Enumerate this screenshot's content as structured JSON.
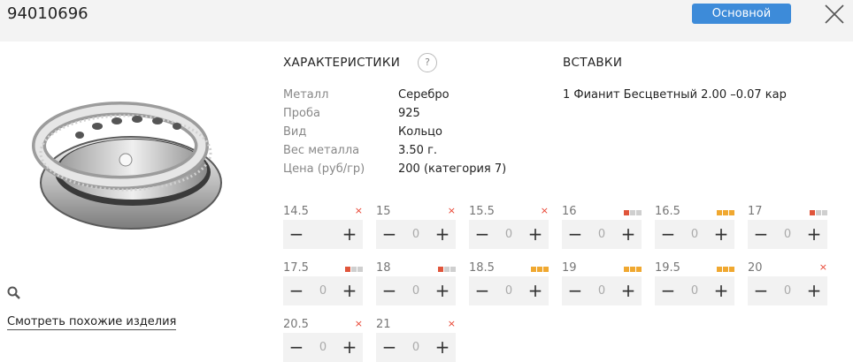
{
  "header": {
    "article": "94010696",
    "main_button": "Основной"
  },
  "image": {
    "alt": "ring"
  },
  "similar_link": "Смотреть похожие изделия",
  "characteristics": {
    "title": "ХАРАКТЕРИСТИКИ",
    "help": "?",
    "rows": [
      {
        "label": "Металл",
        "value": "Серебро"
      },
      {
        "label": "Проба",
        "value": "925"
      },
      {
        "label": "Вид",
        "value": "Кольцо"
      },
      {
        "label": "Вес металла",
        "value": "3.50 г."
      },
      {
        "label": "Цена (руб/гр)",
        "value": "200 (категория 7)"
      }
    ]
  },
  "inserts": {
    "title": "ВСТАВКИ",
    "items": [
      "1 Фианит Бесцветный 2.00 –0.07 кар"
    ]
  },
  "colors": {
    "accent": "#3d8bd9",
    "unavailable": "#e8412f",
    "bar_red": "#e0553b",
    "bar_orange": "#f0a830",
    "bar_grey": "#cfcfcf"
  },
  "sizes": [
    {
      "size": "14.5",
      "qty": "",
      "availability": "none"
    },
    {
      "size": "15",
      "qty": "0",
      "availability": "none"
    },
    {
      "size": "15.5",
      "qty": "0",
      "availability": "none"
    },
    {
      "size": "16",
      "qty": "0",
      "availability": "low"
    },
    {
      "size": "16.5",
      "qty": "0",
      "availability": "high"
    },
    {
      "size": "17",
      "qty": "0",
      "availability": "low"
    },
    {
      "size": "17.5",
      "qty": "0",
      "availability": "low"
    },
    {
      "size": "18",
      "qty": "0",
      "availability": "low"
    },
    {
      "size": "18.5",
      "qty": "0",
      "availability": "high"
    },
    {
      "size": "19",
      "qty": "0",
      "availability": "high"
    },
    {
      "size": "19.5",
      "qty": "0",
      "availability": "high"
    },
    {
      "size": "20",
      "qty": "0",
      "availability": "none"
    },
    {
      "size": "20.5",
      "qty": "0",
      "availability": "none"
    },
    {
      "size": "21",
      "qty": "0",
      "availability": "none"
    }
  ],
  "stepper": {
    "minus": "−",
    "plus": "+"
  }
}
